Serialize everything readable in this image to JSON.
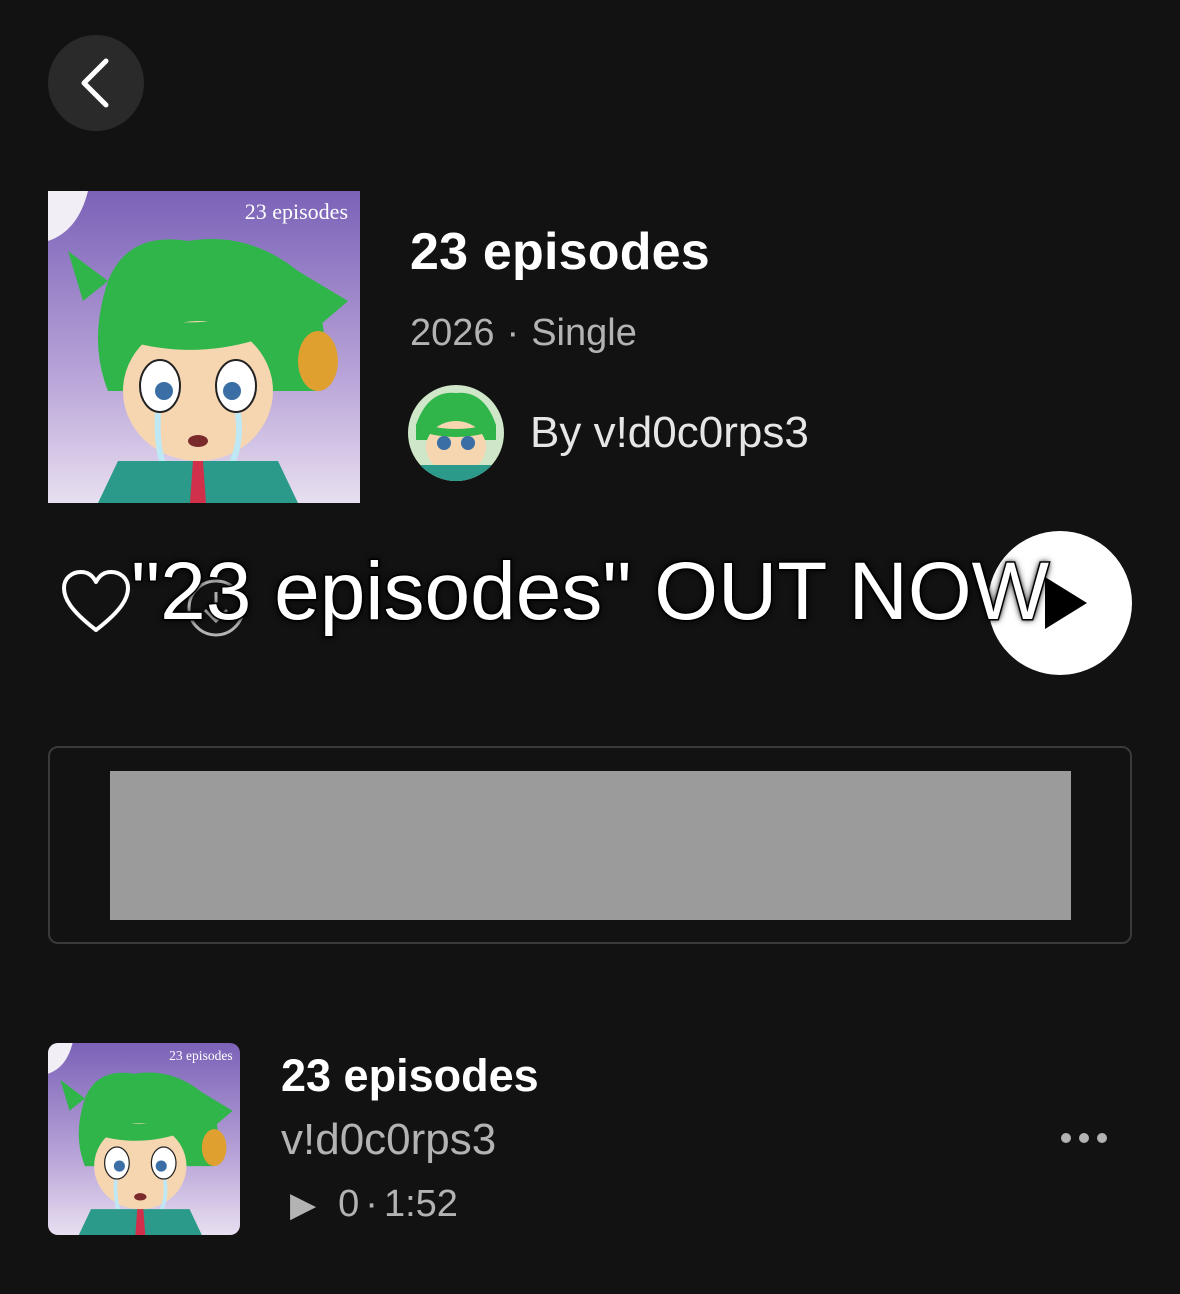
{
  "header": {
    "back_icon": "chevron-left-icon"
  },
  "album": {
    "cover_caption": "23 episodes",
    "title": "23 episodes",
    "year": "2026",
    "separator": "·",
    "type": "Single",
    "artist_line": "By v!d0c0rps3"
  },
  "actions": {
    "like_icon": "heart-outline-icon",
    "download_icon": "download-circle-icon",
    "play_icon": "play-icon"
  },
  "overlay": {
    "caption": "\"23 episodes\" OUT NOW"
  },
  "track": {
    "cover_caption": "23 episodes",
    "title": "23 episodes",
    "artist": "v!d0c0rps3",
    "plays": "0",
    "separator": "·",
    "duration": "1:52",
    "more_icon": "more-horizontal-icon"
  },
  "colors": {
    "background": "#121212",
    "primary_text": "#ffffff",
    "secondary_text": "#b3b3b3",
    "banner_fill": "#9b9b9b"
  }
}
